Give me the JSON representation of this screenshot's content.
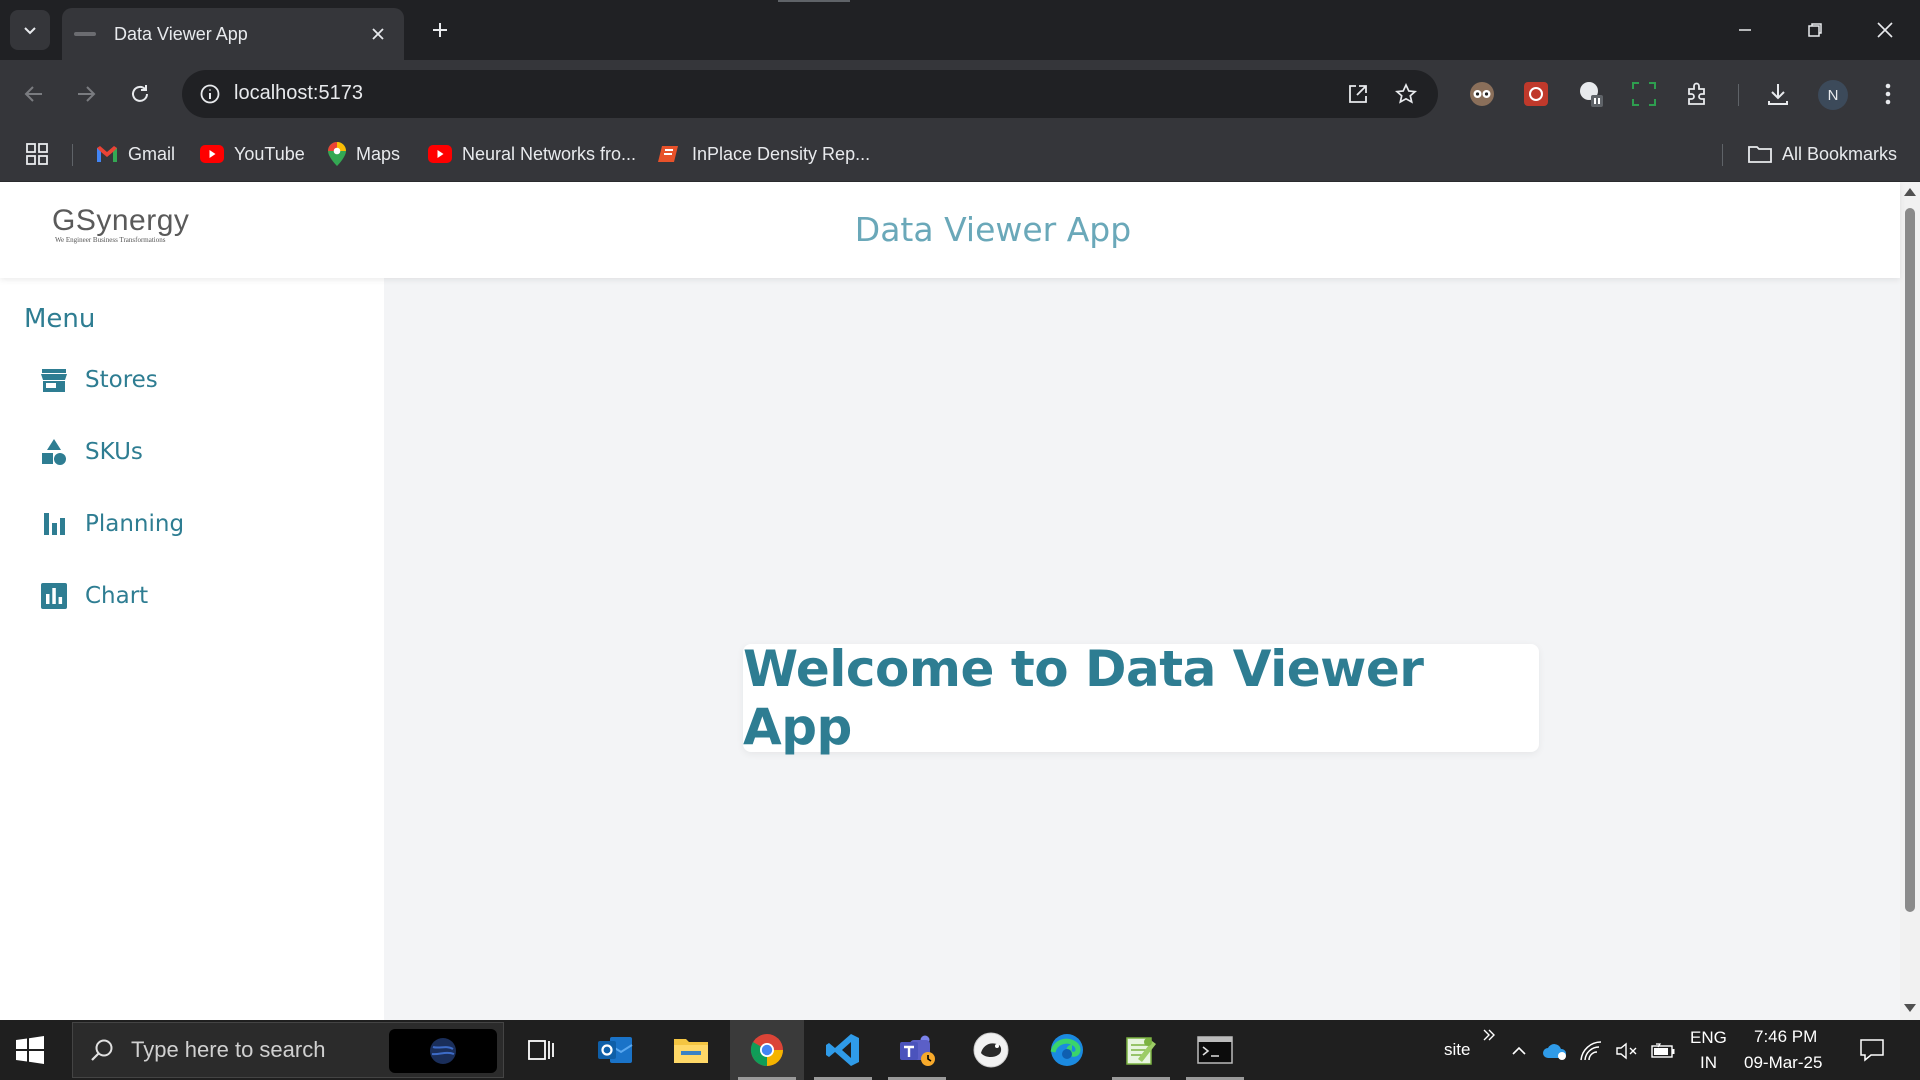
{
  "browser": {
    "tab_title": "Data Viewer App",
    "url": "localhost:5173",
    "profile_initial": "N"
  },
  "bookmarks": [
    {
      "label": "Gmail",
      "icon": "gmail-icon"
    },
    {
      "label": "YouTube",
      "icon": "youtube-icon"
    },
    {
      "label": "Maps",
      "icon": "maps-icon"
    },
    {
      "label": "Neural Networks fro...",
      "icon": "youtube-icon"
    },
    {
      "label": "InPlace Density Rep...",
      "icon": "pdf-icon"
    }
  ],
  "all_bookmarks_label": "All Bookmarks",
  "app": {
    "logo_text": "GSynergy",
    "logo_tagline": "We Engineer Business Transformations",
    "title": "Data Viewer App",
    "menu_title": "Menu",
    "menu_items": [
      {
        "label": "Stores",
        "icon": "store-icon"
      },
      {
        "label": "SKUs",
        "icon": "shapes-icon"
      },
      {
        "label": "Planning",
        "icon": "bar-chart-icon"
      },
      {
        "label": "Chart",
        "icon": "chart-box-icon"
      }
    ],
    "welcome_text": "Welcome to Data Viewer App"
  },
  "taskbar": {
    "search_placeholder": "Type here to search",
    "site_label": "site",
    "lang_line1": "ENG",
    "lang_line2": "IN",
    "time": "7:46 PM",
    "date": "09-Mar-25"
  },
  "colors": {
    "accent": "#2e7d92",
    "title_light": "#6aa8b9",
    "page_bg": "#f3f4f6",
    "browser_dark": "#202124",
    "browser_toolbar": "#35363a"
  }
}
